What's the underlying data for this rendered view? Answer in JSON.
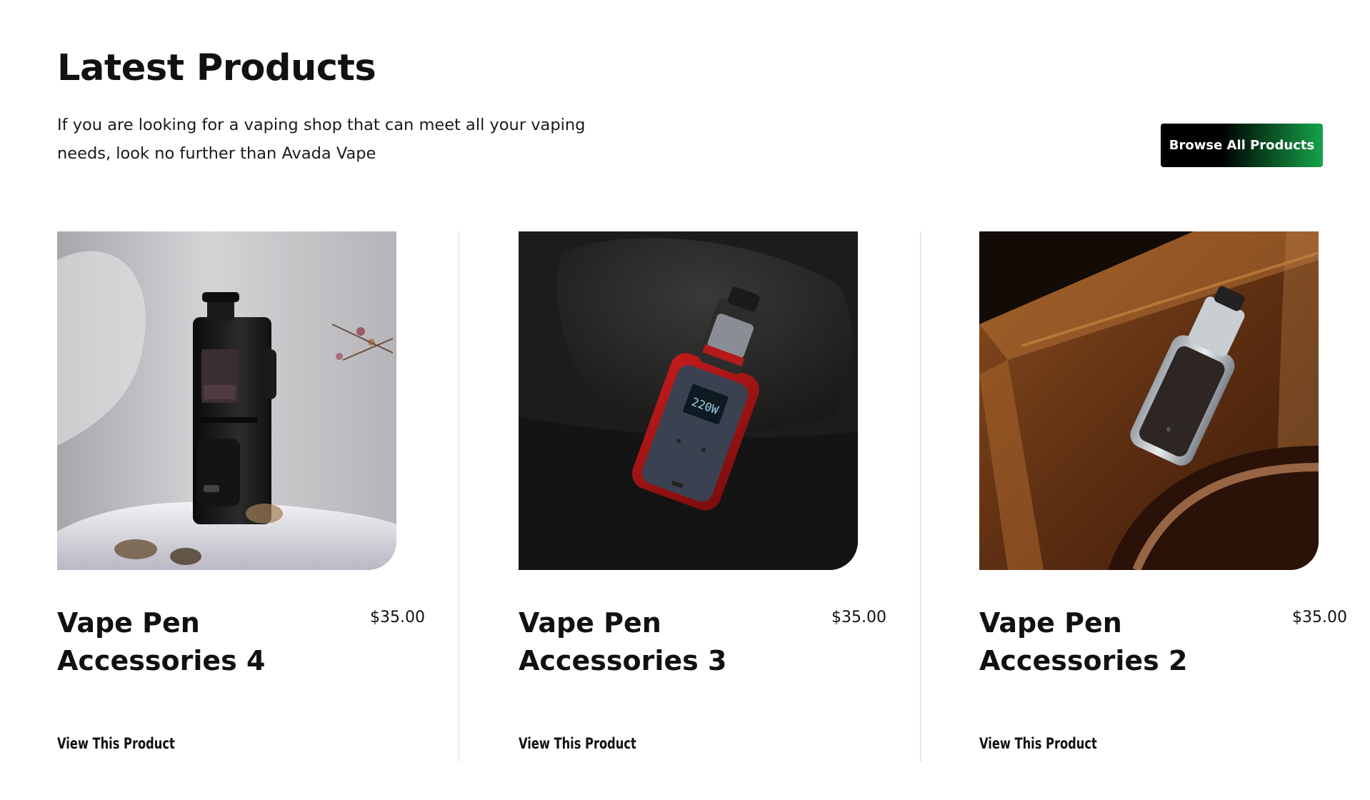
{
  "section": {
    "title": "Latest Products",
    "description": "If you are looking for a vaping shop that can meet all your vaping needs, look no further than Avada Vape",
    "browse_button": "Browse All Products"
  },
  "products": [
    {
      "name": "Vape Pen Accessories 4",
      "price": "$35.00",
      "link_label": "View This Product",
      "image_icon": "box-mod-on-white-cloth-image"
    },
    {
      "name": "Vape Pen Accessories 3",
      "price": "$35.00",
      "link_label": "View This Product",
      "image_icon": "red-mod-on-lava-rock-image"
    },
    {
      "name": "Vape Pen Accessories 2",
      "price": "$35.00",
      "link_label": "View This Product",
      "image_icon": "silver-mod-on-wood-image"
    }
  ],
  "screen_text": {
    "device_display": "220W"
  },
  "colors": {
    "button_gradient_end": "#16a34a",
    "divider": "#d4d4d4"
  }
}
